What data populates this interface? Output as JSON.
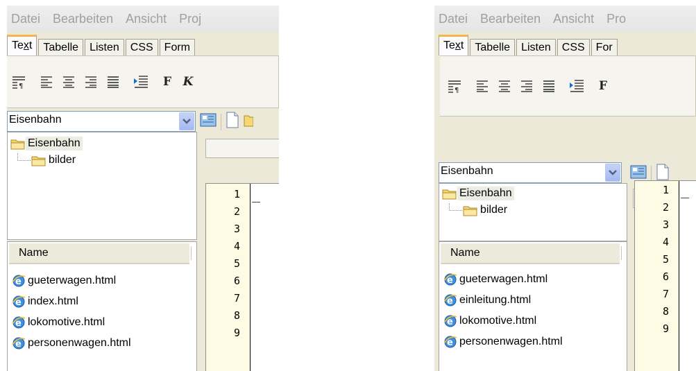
{
  "left": {
    "menu": [
      "Datei",
      "Bearbeiten",
      "Ansicht",
      "Proj"
    ],
    "tabs": {
      "text_pre": "Te",
      "text_ul": "x",
      "text_post": "t",
      "items": [
        "Tabelle",
        "Listen",
        "CSS",
        "Form"
      ]
    },
    "folder_select": "Eisenbahn",
    "tree": {
      "root": "Eisenbahn",
      "child": "bilder"
    },
    "filelist": {
      "header": "Name",
      "files": [
        "gueterwagen.html",
        "index.html",
        "lokomotive.html",
        "personenwagen.html"
      ]
    },
    "toolbar_letters": [
      "F",
      "K"
    ],
    "line_numbers": [
      "1",
      "2",
      "3",
      "4",
      "5",
      "6",
      "7",
      "8",
      "9"
    ]
  },
  "right": {
    "menu": [
      "Datei",
      "Bearbeiten",
      "Ansicht",
      "Pro"
    ],
    "tabs": {
      "text_pre": "Te",
      "text_ul": "x",
      "text_post": "t",
      "items": [
        "Tabelle",
        "Listen",
        "CSS",
        "For"
      ]
    },
    "folder_select": "Eisenbahn",
    "tree": {
      "root": "Eisenbahn",
      "child": "bilder"
    },
    "filelist": {
      "header": "Name",
      "files": [
        "gueterwagen.html",
        "einleitung.html",
        "lokomotive.html",
        "personenwagen.html"
      ]
    },
    "toolbar_letters": [
      "F"
    ],
    "line_numbers": [
      "1",
      "2",
      "3",
      "4",
      "5",
      "6",
      "7",
      "8",
      "9"
    ]
  },
  "icons": {
    "paragraph": "paragraph-icon",
    "align_left": "align-left-icon",
    "align_center": "align-center-icon",
    "align_right": "align-right-icon",
    "justify": "justify-icon",
    "indent": "indent-icon",
    "folder": "folder-icon",
    "ie_file": "html-file-icon",
    "chevron": "chevron-down-icon"
  },
  "colors": {
    "accent_tab": "#f7b44a",
    "gutter": "#fdfbe4",
    "select_arrow": "#a3b9ef"
  }
}
